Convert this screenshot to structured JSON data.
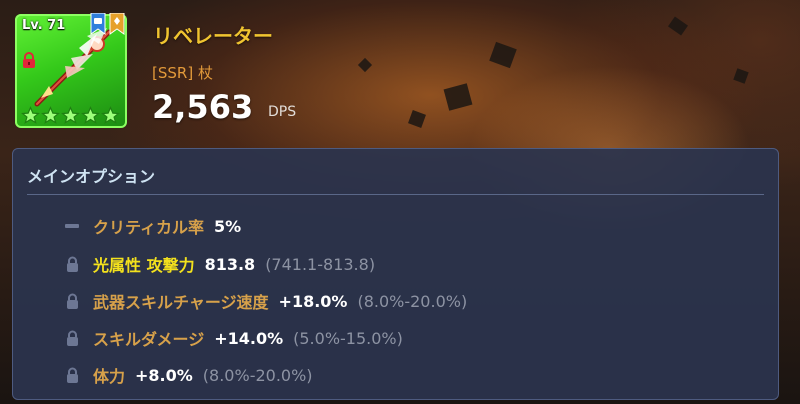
{
  "item": {
    "level": "Lv. 71",
    "name": "リベレーター",
    "rarity_type": "[SSR] 杖",
    "dps_value": "2,563",
    "dps_label": "DPS",
    "stars": 5,
    "card_color": "#3fd622",
    "locked": true
  },
  "main_options": {
    "title": "メインオプション",
    "rows": [
      {
        "icon": "dash-icon",
        "name": "クリティカル率",
        "value": "5%",
        "range": "",
        "name_color": "orange"
      },
      {
        "icon": "lock-icon",
        "name": "光属性 攻撃力",
        "value": "813.8",
        "range": "(741.1-813.8)",
        "name_color": "yellow"
      },
      {
        "icon": "lock-icon",
        "name": "武器スキルチャージ速度",
        "value": "+18.0%",
        "range": "(8.0%-20.0%)",
        "name_color": "orange"
      },
      {
        "icon": "lock-icon",
        "name": "スキルダメージ",
        "value": "+14.0%",
        "range": "(5.0%-15.0%)",
        "name_color": "orange"
      },
      {
        "icon": "lock-icon",
        "name": "体力",
        "value": "+8.0%",
        "range": "(8.0%-20.0%)",
        "name_color": "orange"
      }
    ]
  },
  "colors": {
    "name_gold": "#f0c430",
    "rarity_orange": "#e39a3a",
    "option_orange": "#d7a14a",
    "option_yellow": "#f3e11d",
    "range_gray": "#8d93a3",
    "panel_bg": "#2b344d"
  }
}
